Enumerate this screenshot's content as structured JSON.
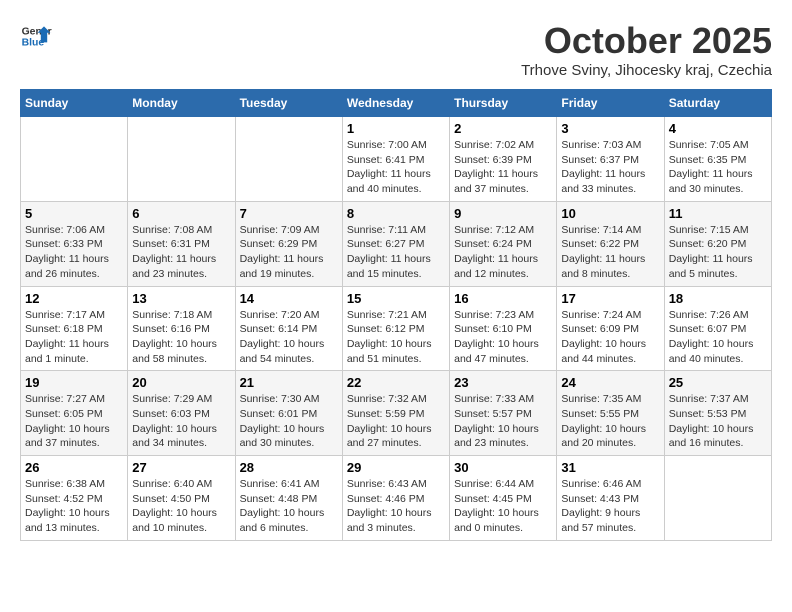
{
  "header": {
    "logo_line1": "General",
    "logo_line2": "Blue",
    "month": "October 2025",
    "location": "Trhove Sviny, Jihocesky kraj, Czechia"
  },
  "weekdays": [
    "Sunday",
    "Monday",
    "Tuesday",
    "Wednesday",
    "Thursday",
    "Friday",
    "Saturday"
  ],
  "weeks": [
    [
      {
        "day": "",
        "info": ""
      },
      {
        "day": "",
        "info": ""
      },
      {
        "day": "",
        "info": ""
      },
      {
        "day": "1",
        "info": "Sunrise: 7:00 AM\nSunset: 6:41 PM\nDaylight: 11 hours\nand 40 minutes."
      },
      {
        "day": "2",
        "info": "Sunrise: 7:02 AM\nSunset: 6:39 PM\nDaylight: 11 hours\nand 37 minutes."
      },
      {
        "day": "3",
        "info": "Sunrise: 7:03 AM\nSunset: 6:37 PM\nDaylight: 11 hours\nand 33 minutes."
      },
      {
        "day": "4",
        "info": "Sunrise: 7:05 AM\nSunset: 6:35 PM\nDaylight: 11 hours\nand 30 minutes."
      }
    ],
    [
      {
        "day": "5",
        "info": "Sunrise: 7:06 AM\nSunset: 6:33 PM\nDaylight: 11 hours\nand 26 minutes."
      },
      {
        "day": "6",
        "info": "Sunrise: 7:08 AM\nSunset: 6:31 PM\nDaylight: 11 hours\nand 23 minutes."
      },
      {
        "day": "7",
        "info": "Sunrise: 7:09 AM\nSunset: 6:29 PM\nDaylight: 11 hours\nand 19 minutes."
      },
      {
        "day": "8",
        "info": "Sunrise: 7:11 AM\nSunset: 6:27 PM\nDaylight: 11 hours\nand 15 minutes."
      },
      {
        "day": "9",
        "info": "Sunrise: 7:12 AM\nSunset: 6:24 PM\nDaylight: 11 hours\nand 12 minutes."
      },
      {
        "day": "10",
        "info": "Sunrise: 7:14 AM\nSunset: 6:22 PM\nDaylight: 11 hours\nand 8 minutes."
      },
      {
        "day": "11",
        "info": "Sunrise: 7:15 AM\nSunset: 6:20 PM\nDaylight: 11 hours\nand 5 minutes."
      }
    ],
    [
      {
        "day": "12",
        "info": "Sunrise: 7:17 AM\nSunset: 6:18 PM\nDaylight: 11 hours\nand 1 minute."
      },
      {
        "day": "13",
        "info": "Sunrise: 7:18 AM\nSunset: 6:16 PM\nDaylight: 10 hours\nand 58 minutes."
      },
      {
        "day": "14",
        "info": "Sunrise: 7:20 AM\nSunset: 6:14 PM\nDaylight: 10 hours\nand 54 minutes."
      },
      {
        "day": "15",
        "info": "Sunrise: 7:21 AM\nSunset: 6:12 PM\nDaylight: 10 hours\nand 51 minutes."
      },
      {
        "day": "16",
        "info": "Sunrise: 7:23 AM\nSunset: 6:10 PM\nDaylight: 10 hours\nand 47 minutes."
      },
      {
        "day": "17",
        "info": "Sunrise: 7:24 AM\nSunset: 6:09 PM\nDaylight: 10 hours\nand 44 minutes."
      },
      {
        "day": "18",
        "info": "Sunrise: 7:26 AM\nSunset: 6:07 PM\nDaylight: 10 hours\nand 40 minutes."
      }
    ],
    [
      {
        "day": "19",
        "info": "Sunrise: 7:27 AM\nSunset: 6:05 PM\nDaylight: 10 hours\nand 37 minutes."
      },
      {
        "day": "20",
        "info": "Sunrise: 7:29 AM\nSunset: 6:03 PM\nDaylight: 10 hours\nand 34 minutes."
      },
      {
        "day": "21",
        "info": "Sunrise: 7:30 AM\nSunset: 6:01 PM\nDaylight: 10 hours\nand 30 minutes."
      },
      {
        "day": "22",
        "info": "Sunrise: 7:32 AM\nSunset: 5:59 PM\nDaylight: 10 hours\nand 27 minutes."
      },
      {
        "day": "23",
        "info": "Sunrise: 7:33 AM\nSunset: 5:57 PM\nDaylight: 10 hours\nand 23 minutes."
      },
      {
        "day": "24",
        "info": "Sunrise: 7:35 AM\nSunset: 5:55 PM\nDaylight: 10 hours\nand 20 minutes."
      },
      {
        "day": "25",
        "info": "Sunrise: 7:37 AM\nSunset: 5:53 PM\nDaylight: 10 hours\nand 16 minutes."
      }
    ],
    [
      {
        "day": "26",
        "info": "Sunrise: 6:38 AM\nSunset: 4:52 PM\nDaylight: 10 hours\nand 13 minutes."
      },
      {
        "day": "27",
        "info": "Sunrise: 6:40 AM\nSunset: 4:50 PM\nDaylight: 10 hours\nand 10 minutes."
      },
      {
        "day": "28",
        "info": "Sunrise: 6:41 AM\nSunset: 4:48 PM\nDaylight: 10 hours\nand 6 minutes."
      },
      {
        "day": "29",
        "info": "Sunrise: 6:43 AM\nSunset: 4:46 PM\nDaylight: 10 hours\nand 3 minutes."
      },
      {
        "day": "30",
        "info": "Sunrise: 6:44 AM\nSunset: 4:45 PM\nDaylight: 10 hours\nand 0 minutes."
      },
      {
        "day": "31",
        "info": "Sunrise: 6:46 AM\nSunset: 4:43 PM\nDaylight: 9 hours\nand 57 minutes."
      },
      {
        "day": "",
        "info": ""
      }
    ]
  ]
}
